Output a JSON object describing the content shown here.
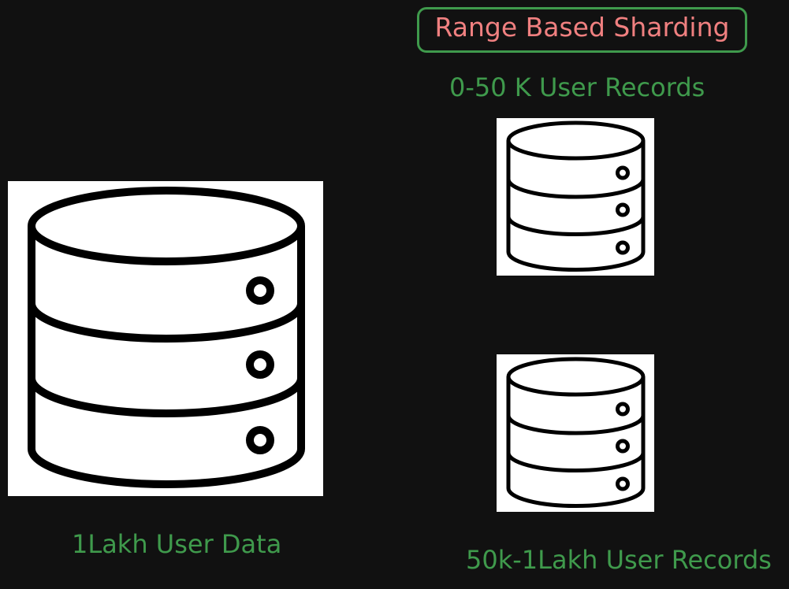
{
  "title": "Range Based Sharding",
  "main_db": {
    "label": "1Lakh User Data",
    "icon": "database-icon"
  },
  "shards": [
    {
      "label": "0-50 K User Records",
      "icon": "database-icon"
    },
    {
      "label": "50k-1Lakh User Records",
      "icon": "database-icon"
    }
  ],
  "colors": {
    "background": "#111111",
    "label_green": "#3f9a4c",
    "title_red": "#f08080",
    "icon_panel": "#ffffff",
    "icon_stroke": "#000000"
  }
}
